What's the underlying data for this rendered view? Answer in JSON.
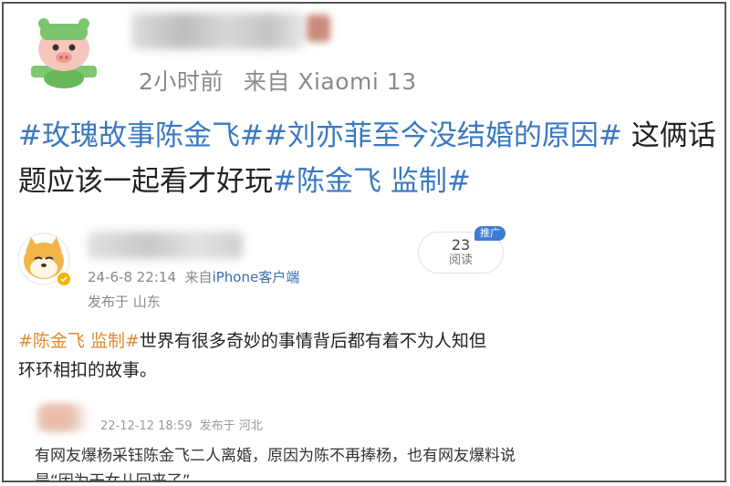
{
  "post_main": {
    "time": "2小时前",
    "source": "来自 Xiaomi 13",
    "segments": [
      {
        "text": "#玫瑰故事陈金飞##刘亦菲至今没结婚的原因#",
        "type": "topic"
      },
      {
        "text": " 这俩话题应该一起看才好玩",
        "type": "plain"
      },
      {
        "text": "#陈金飞 监制#",
        "type": "topic"
      }
    ]
  },
  "card_repost": {
    "datetime": "24-6-8 22:14",
    "source_prefix": "来自",
    "source_device": "iPhone客户端",
    "location": "发布于 山东",
    "read_count": "23",
    "read_label": "阅读",
    "promo_badge": "推广",
    "topic": "#陈金飞 监制#",
    "body": "世界有很多奇妙的事情背后都有着不为人知但环环相扣的故事。"
  },
  "card_quote": {
    "datetime": "22-12-12 18:59",
    "location": "发布于 河北",
    "body": "有网友爆杨采钰陈金飞二人离婚，原因为陈不再捧杨，也有网友爆料说是“因为干女儿回来了”"
  },
  "colors": {
    "topic_blue": "#3a78c2",
    "topic_orange": "#e08a2e",
    "meta_gray": "#8a8a8a"
  }
}
